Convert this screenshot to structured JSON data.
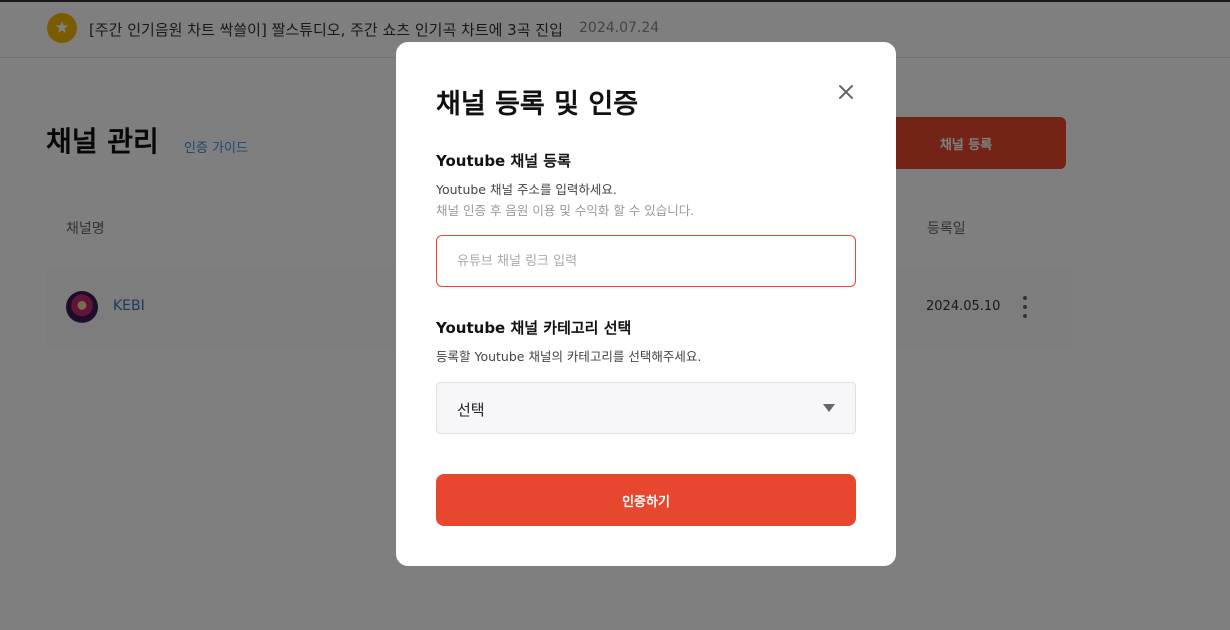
{
  "notice": {
    "icon": "star-icon",
    "text": "[주간 인기음원 차트 싹쓸이] 짤스튜디오, 주간 쇼츠 인기곡 차트에 3곡 진입",
    "date": "2024.07.24"
  },
  "header": {
    "title": "채널 관리",
    "guide_link": "인증 가이드",
    "register_button": "채널 등록"
  },
  "table": {
    "columns": {
      "name": "채널명",
      "date": "등록일"
    },
    "rows": [
      {
        "name": "KEBI",
        "date": "2024.05.10"
      }
    ]
  },
  "modal": {
    "title": "채널 등록 및 인증",
    "section1": {
      "title": "Youtube 채널 등록",
      "desc": "Youtube 채널 주소를 입력하세요.",
      "sub": "채널 인증 후 음원 이용 및 수익화 할 수 있습니다.",
      "input_placeholder": "유튜브 채널 링크 입력",
      "input_value": ""
    },
    "section2": {
      "title": "Youtube 채널 카테고리 선택",
      "desc": "등록할 Youtube 채널의 카테고리를 선택해주세요.",
      "selected": "선택"
    },
    "submit_label": "인증하기"
  },
  "colors": {
    "accent": "#e8472f",
    "link": "#3a8ee0",
    "badge": "#f5b800"
  }
}
